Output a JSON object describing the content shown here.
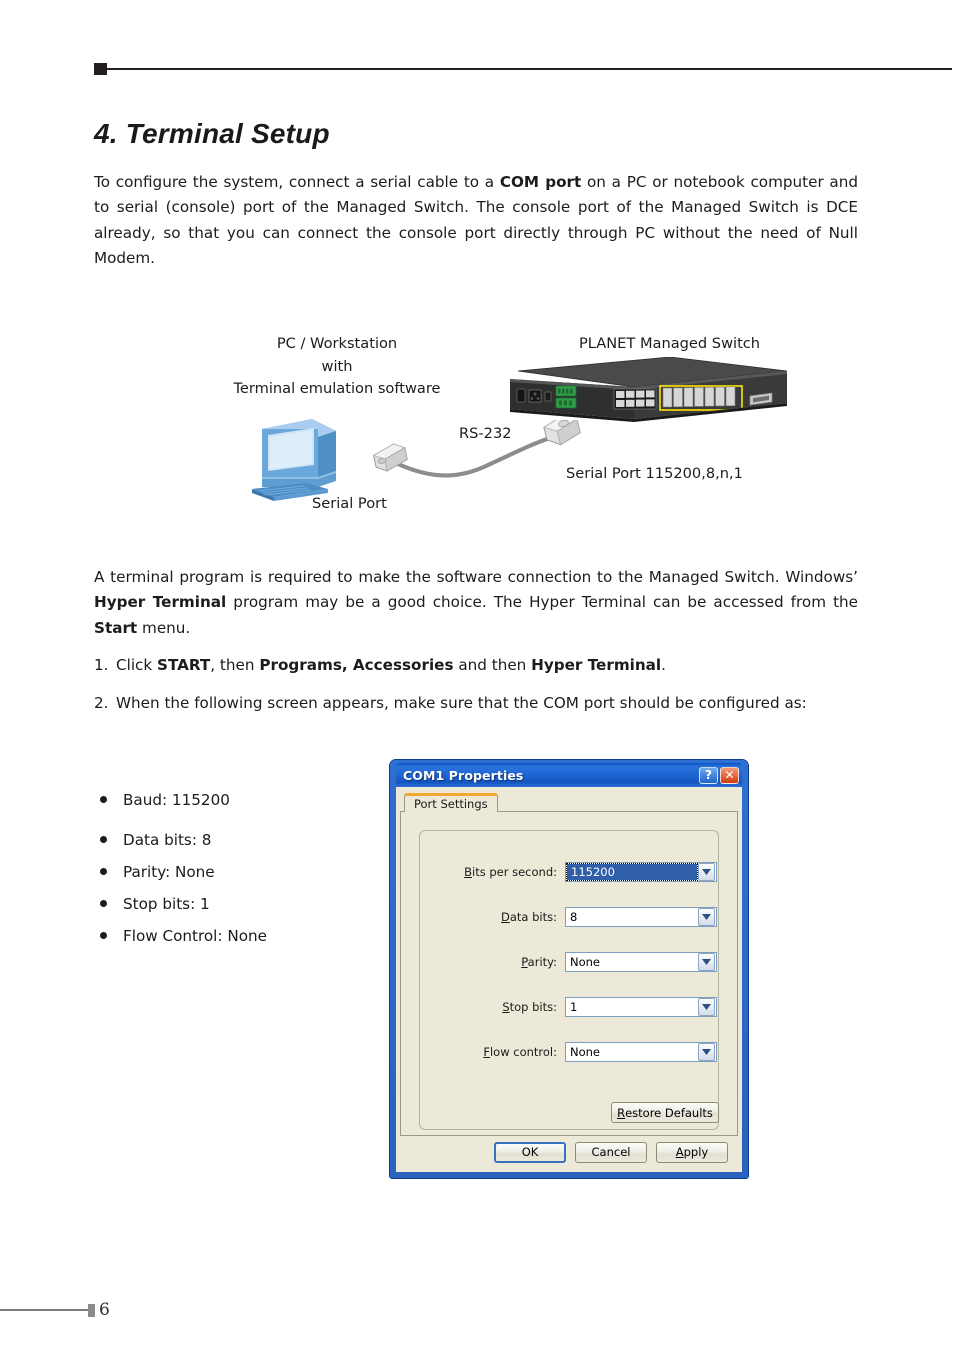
{
  "header": {
    "rule": "top-rule"
  },
  "chapter": {
    "title": "4. Terminal Setup"
  },
  "intro": {
    "t1": "To configure the system, connect a serial cable to a ",
    "b1": "COM port",
    "t2": " on a PC or notebook computer and to serial (console) port of the Managed Switch. The console port of the Managed Switch is DCE already, so that you can connect the console port directly through PC without the need of Null Modem."
  },
  "diagram": {
    "pc_label": "PC / Workstation\nwith\nTerminal emulation software",
    "pc_label_line1": "PC / Workstation",
    "pc_label_line2": "with",
    "pc_label_line3": "Terminal emulation software",
    "switch_label": "PLANET Managed Switch",
    "cable_label": "RS-232",
    "pc_port_label": "Serial Port",
    "switch_port_label": "Serial Port 115200,8,n,1"
  },
  "middle": {
    "t1": "A terminal program is required to make the software connection to the Managed Switch. Windows’ ",
    "b1": "Hyper Terminal",
    "t2": " program may be a good choice. The Hyper Terminal can be accessed from the ",
    "b2": "Start",
    "t3": " menu."
  },
  "steps": [
    {
      "num": "1.",
      "t1": "Click ",
      "b1": "START",
      "t2": ", then ",
      "b2": "Programs, Accessories",
      "t3": " and then ",
      "b3": "Hyper Terminal",
      "t4": "."
    },
    {
      "num": "2.",
      "t1": "When the following screen appears, make sure that the COM port should be configured as:",
      "b1": "",
      "t2": "",
      "b2": "",
      "t3": "",
      "b3": "",
      "t4": ""
    }
  ],
  "bullets": [
    "Baud: 115200",
    "Data bits: 8",
    "Parity: None",
    "Stop bits: 1",
    "Flow Control: None"
  ],
  "dialog": {
    "title": "COM1 Properties",
    "help_button": "?",
    "close_button": "✕",
    "tab": "Port Settings",
    "fields": [
      {
        "label_accel": "B",
        "label_rest": "its per second:",
        "value": "115200",
        "focused": true
      },
      {
        "label_accel": "D",
        "label_rest": "ata bits:",
        "value": "8",
        "focused": false
      },
      {
        "label_accel": "P",
        "label_rest": "arity:",
        "value": "None",
        "focused": false
      },
      {
        "label_accel": "S",
        "label_rest": "top bits:",
        "value": "1",
        "focused": false
      },
      {
        "label_accel": "F",
        "label_rest": "low control:",
        "value": "None",
        "focused": false
      }
    ],
    "restore_accel": "R",
    "restore_rest": "estore Defaults",
    "ok": "OK",
    "cancel": "Cancel",
    "apply_accel": "A",
    "apply_rest": "pply",
    "colors": {
      "titlebar_blue": "#1f66d4",
      "dialog_face": "#ece9d8",
      "tab_orange": "#f0a830",
      "selection_blue": "#2f5fa8",
      "close_red": "#cf3a10"
    }
  },
  "footer": {
    "page_number": "6"
  }
}
